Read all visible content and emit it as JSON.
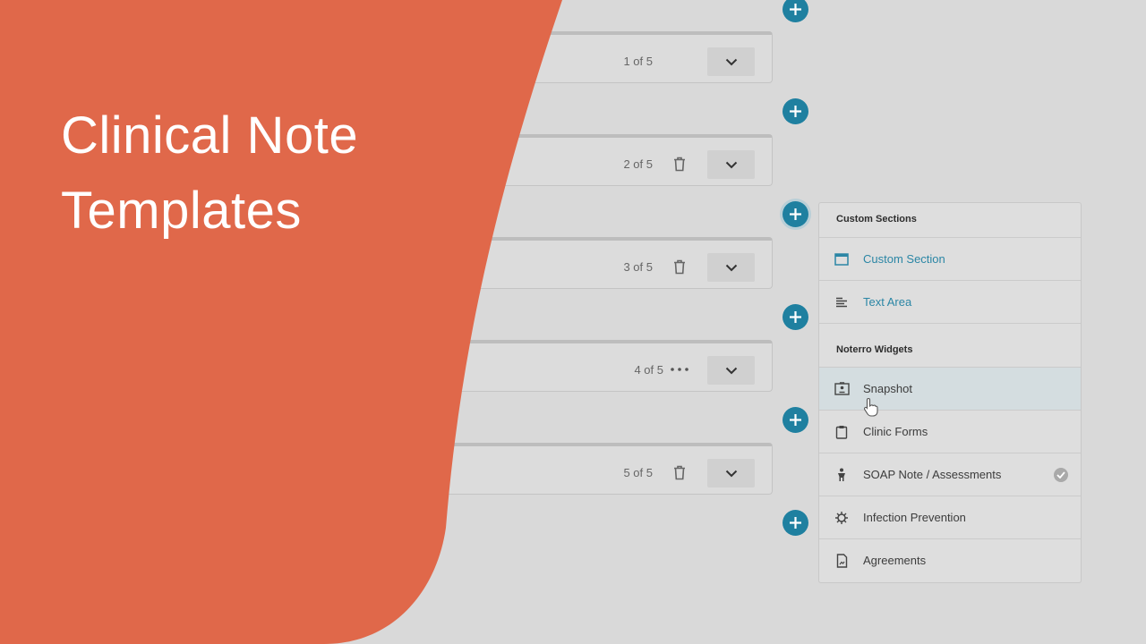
{
  "title": {
    "line1": "Clinical Note",
    "line2": "Templates"
  },
  "colors": {
    "accent_orange": "#e0684a",
    "add_button": "#1f80a0",
    "link_blue": "#2b86a5"
  },
  "sections": [
    {
      "count": "1 of 5",
      "action_icon": "none"
    },
    {
      "count": "2 of 5",
      "action_icon": "trash-icon"
    },
    {
      "count": "3 of 5",
      "action_icon": "trash-icon"
    },
    {
      "count": "4 of 5",
      "action_icon": "more-horizontal-icon"
    },
    {
      "count": "5 of 5",
      "action_icon": "trash-icon"
    }
  ],
  "menu": {
    "custom_header": "Custom Sections",
    "custom_items": [
      {
        "label": "Custom Section",
        "icon": "window-icon"
      },
      {
        "label": "Text Area",
        "icon": "text-lines-icon"
      }
    ],
    "widgets_header": "Noterro Widgets",
    "widget_items": [
      {
        "label": "Snapshot",
        "icon": "id-card-icon"
      },
      {
        "label": "Clinic Forms",
        "icon": "clipboard-icon"
      },
      {
        "label": "SOAP Note / Assessments",
        "icon": "person-icon",
        "badge": "check-circle-icon"
      },
      {
        "label": "Infection Prevention",
        "icon": "virus-icon"
      },
      {
        "label": "Agreements",
        "icon": "document-icon"
      }
    ]
  }
}
